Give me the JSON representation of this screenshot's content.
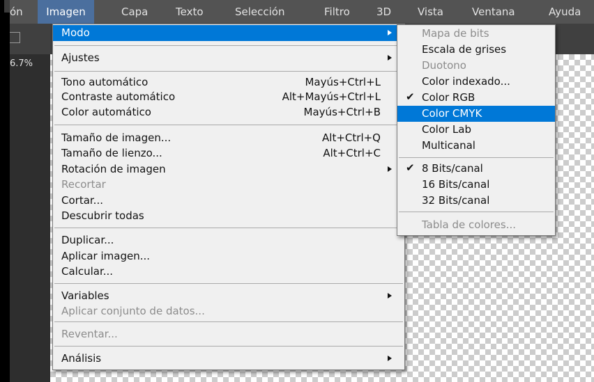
{
  "menubar": {
    "items": [
      "ón",
      "Imagen",
      "Capa",
      "Texto",
      "Selección",
      "Filtro",
      "3D",
      "Vista",
      "Ventana",
      "Ayuda"
    ]
  },
  "toolbar": {
    "zoom": "6.7%"
  },
  "image_menu": {
    "items": [
      {
        "label": "Modo"
      },
      {
        "label": "Ajustes"
      },
      {
        "label": "Tono automático",
        "shortcut": "Mayús+Ctrl+L"
      },
      {
        "label": "Contraste automático",
        "shortcut": "Alt+Mayús+Ctrl+L"
      },
      {
        "label": "Color automático",
        "shortcut": "Mayús+Ctrl+B"
      },
      {
        "label": "Tamaño de imagen...",
        "shortcut": "Alt+Ctrl+Q"
      },
      {
        "label": "Tamaño de lienzo...",
        "shortcut": "Alt+Ctrl+C"
      },
      {
        "label": "Rotación de imagen"
      },
      {
        "label": "Recortar"
      },
      {
        "label": "Cortar..."
      },
      {
        "label": "Descubrir todas"
      },
      {
        "label": "Duplicar..."
      },
      {
        "label": "Aplicar imagen..."
      },
      {
        "label": "Calcular..."
      },
      {
        "label": "Variables"
      },
      {
        "label": "Aplicar conjunto de datos..."
      },
      {
        "label": "Reventar..."
      },
      {
        "label": "Análisis"
      }
    ]
  },
  "mode_submenu": {
    "check_glyph": "✔",
    "items": [
      {
        "label": "Mapa de bits"
      },
      {
        "label": "Escala de grises"
      },
      {
        "label": "Duotono"
      },
      {
        "label": "Color indexado..."
      },
      {
        "label": "Color RGB"
      },
      {
        "label": "Color CMYK"
      },
      {
        "label": "Color Lab"
      },
      {
        "label": "Multicanal"
      },
      {
        "label": "8 Bits/canal"
      },
      {
        "label": "16 Bits/canal"
      },
      {
        "label": "32 Bits/canal"
      },
      {
        "label": "Tabla de colores..."
      }
    ]
  },
  "colors": {
    "highlight": "#0078d7",
    "menubar_bg": "#535353",
    "menu_bg": "#f0f0f0",
    "disabled_text": "#8c8c8c"
  }
}
